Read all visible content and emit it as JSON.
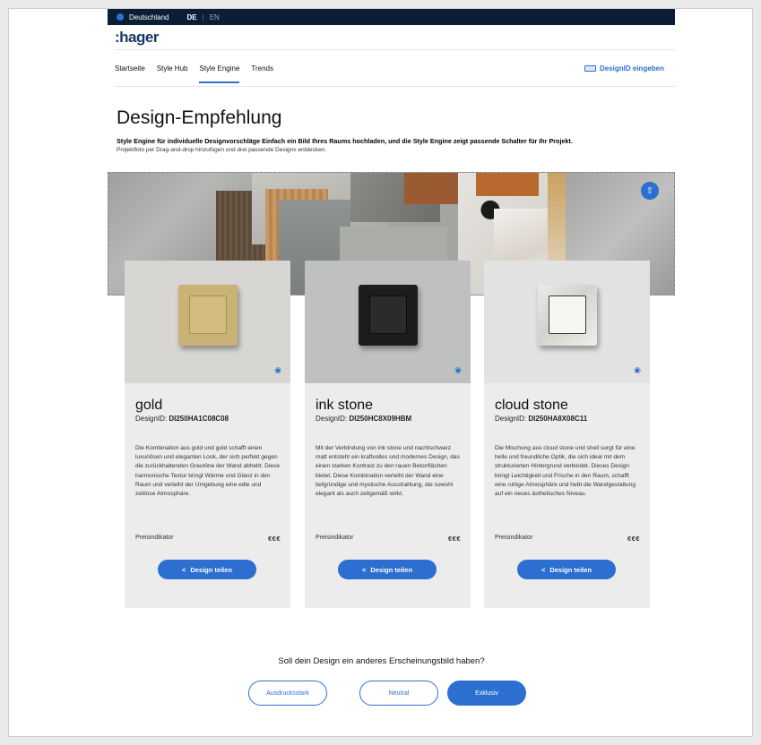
{
  "topbar": {
    "country": "Deutschland",
    "lang_de": "DE",
    "lang_separator": "|",
    "lang_en": "EN"
  },
  "brand": {
    "logo": ":hager"
  },
  "nav": {
    "items": [
      {
        "label": "Startseite"
      },
      {
        "label": "Style Hub"
      },
      {
        "label": "Style Engine",
        "active": true
      },
      {
        "label": "Trends"
      }
    ],
    "designid_label": "DesignID eingeben"
  },
  "page": {
    "title": "Design-Empfehlung",
    "subtitle": "Style Engine für individuelle Designvorschläge Einfach ein Bild Ihres Raums hochladen, und die Style Engine zeigt passende Schalter für Ihr Projekt.",
    "hint": "Projektfoto per Drag-and-drop hinzufügen und drei passende Designs entdecken."
  },
  "cards": [
    {
      "name": "gold",
      "id_prefix": "DesignID: ",
      "id_value": "DI250HA1C08C08",
      "description": "Die Kombination aus gold und gold schafft einen luxuriösen und eleganten Look, der sich perfekt gegen die zurückhaltenden Grautöne der Wand abhebt. Diese harmonische Textur bringt Wärme und Glanz in den Raum und verleiht der Umgebung eine edle und zeitlose Atmosphäre.",
      "price_label": "Preisindikator",
      "price_value": "€€€",
      "share_label": "Design teilen",
      "colors": {
        "background": "#d8d6d2",
        "plate": "#c9b276",
        "rocker": "#d2bb7e"
      }
    },
    {
      "name": "ink stone",
      "id_prefix": "DesignID: ",
      "id_value": "DI250HC8X09HBM",
      "description": "Mit der Verbindung von ink stone und nachtschwarz matt entsteht ein kraftvolles und modernes Design, das einen starken Kontrast zu den rauen Betonflächen bietet. Diese Kombination verleiht der Wand eine tiefgründige und mystische Ausstrahlung, die sowohl elegant als auch zeitgemäß wirkt.",
      "price_label": "Preisindikator",
      "price_value": "€€€",
      "share_label": "Design teilen",
      "colors": {
        "background": "#bfc0c0",
        "plate": "#1c1d1f",
        "rocker": "#2a2b2d"
      }
    },
    {
      "name": "cloud stone",
      "id_prefix": "DesignID: ",
      "id_value": "DI250HA8X08C11",
      "description": "Die Mischung aus cloud stone und shell sorgt für eine helle und freundliche Optik, die sich ideal mit dem strukturierten Hintergrund verbindet. Dieses Design bringt Leichtigkeit und Frische in den Raum, schafft eine ruhige Atmosphäre und hebt die Wandgestaltung auf ein neues ästhetisches Niveau.",
      "price_label": "Preisindikator",
      "price_value": "€€€",
      "share_label": "Design teilen",
      "colors": {
        "background": "#e2e2e2",
        "plate": "#e8e6e1",
        "rocker": "#f7f6f1"
      }
    }
  ],
  "question": {
    "text": "Soll dein Design ein anderes Erscheinungsbild haben?",
    "options": [
      {
        "label": "Ausdrucksstark",
        "selected": false
      },
      {
        "label": "Neutral",
        "selected": false
      },
      {
        "label": "Exklusiv",
        "selected": true
      }
    ]
  },
  "theme": {
    "accent": "#2d6fd0",
    "topbar": "#0b1e37",
    "logo": "#173a6b"
  }
}
